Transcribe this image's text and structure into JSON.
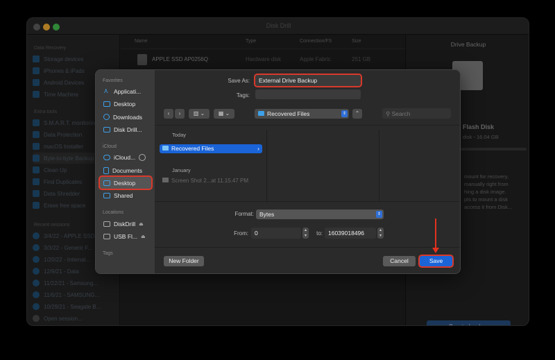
{
  "window": {
    "title": "Disk Drill"
  },
  "sidebar": {
    "sections": [
      {
        "title": "Data Recovery",
        "items": [
          "Storage devices",
          "iPhones & iPads",
          "Android Devices",
          "Time Machine"
        ]
      },
      {
        "title": "Extra tools",
        "items": [
          "S.M.A.R.T. monitoring",
          "Data Protection",
          "macOS Installer",
          "Byte-to-byte Backup",
          "Clean Up",
          "Find Duplicates",
          "Data Shredder",
          "Erase free space"
        ]
      },
      {
        "title": "Recent sessions",
        "items": [
          "3/4/22 - APPLE SSD...",
          "3/3/22 - Generic F...",
          "1/20/22 - Internal...",
          "12/9/21 - Data",
          "11/22/21 - Samsung...",
          "11/6/21 - SAMSUNG...",
          "10/29/21 - Seagate B...",
          "Open session..."
        ]
      }
    ]
  },
  "table": {
    "headers": [
      "Name",
      "Type",
      "Connection/FS",
      "Size"
    ],
    "rows": [
      [
        "APPLE SSD AP0256Q",
        "Hardware disk",
        "Apple Fabric",
        "251 GB"
      ]
    ]
  },
  "right_panel": {
    "title": "Drive Backup",
    "disk_name": "Flash Disk",
    "disk_info": "disk - 16.04 GB",
    "description": [
      "mount for recovery,",
      "manually right from",
      "hing a disk image.",
      "pts to mount a disk",
      "access it from Disk..."
    ],
    "button": "Create backup"
  },
  "dialog": {
    "sidebar": {
      "favorites_title": "Favorites",
      "favorites": [
        "Applicati...",
        "Desktop",
        "Downloads",
        "Disk Drill..."
      ],
      "icloud_title": "iCloud",
      "icloud": [
        "iCloud...",
        "Documents",
        "Desktop",
        "Shared"
      ],
      "locations_title": "Locations",
      "locations": [
        "DiskDrill",
        "USB Fl..."
      ],
      "tags_title": "Tags"
    },
    "save_as_label": "Save As:",
    "save_as_value": "External Drive Backup",
    "tags_label": "Tags:",
    "location": "Recovered Files",
    "search_placeholder": "Search",
    "groups": [
      {
        "title": "Today",
        "items": [
          "Recovered Files"
        ]
      },
      {
        "title": "January",
        "items": [
          "Screen Shot 2...at 11.15.47 PM"
        ]
      }
    ],
    "format_label": "Format:",
    "format_value": "Bytes",
    "from_label": "From:",
    "from_value": "0",
    "to_label": "to:",
    "to_value": "16039018496",
    "new_folder": "New Folder",
    "cancel": "Cancel",
    "save": "Save"
  }
}
